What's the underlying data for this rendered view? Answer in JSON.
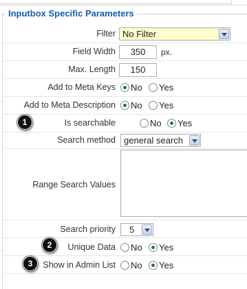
{
  "section_title": "Inputbox Specific Parameters",
  "filter": {
    "label": "Filter",
    "value": "No Filter"
  },
  "field_width": {
    "label": "Field Width",
    "value": "350",
    "unit": "px."
  },
  "max_length": {
    "label": "Max. Length",
    "value": "150"
  },
  "add_meta_keys": {
    "label": "Add to Meta Keys",
    "no": "No",
    "yes": "Yes",
    "selected": "No"
  },
  "add_meta_description": {
    "label": "Add to Meta Description",
    "no": "No",
    "yes": "Yes",
    "selected": "No"
  },
  "is_searchable": {
    "badge": "1",
    "label": "Is searchable",
    "no": "No",
    "yes": "Yes",
    "selected": "Yes"
  },
  "search_method": {
    "label": "Search method",
    "value": "general search"
  },
  "range_search": {
    "label": "Range Search Values",
    "value": ""
  },
  "search_priority": {
    "label": "Search priority",
    "value": "5"
  },
  "unique_data": {
    "badge": "2",
    "label": "Unique Data",
    "no": "No",
    "yes": "Yes",
    "selected": "Yes"
  },
  "show_admin_list": {
    "badge": "3",
    "label": "Show in Admin List",
    "no": "No",
    "yes": "Yes",
    "selected": "Yes"
  },
  "colors": {
    "legend": "#135cae",
    "filter_bg": "#ffffcc",
    "radio_dot": "#2a7a2a"
  }
}
